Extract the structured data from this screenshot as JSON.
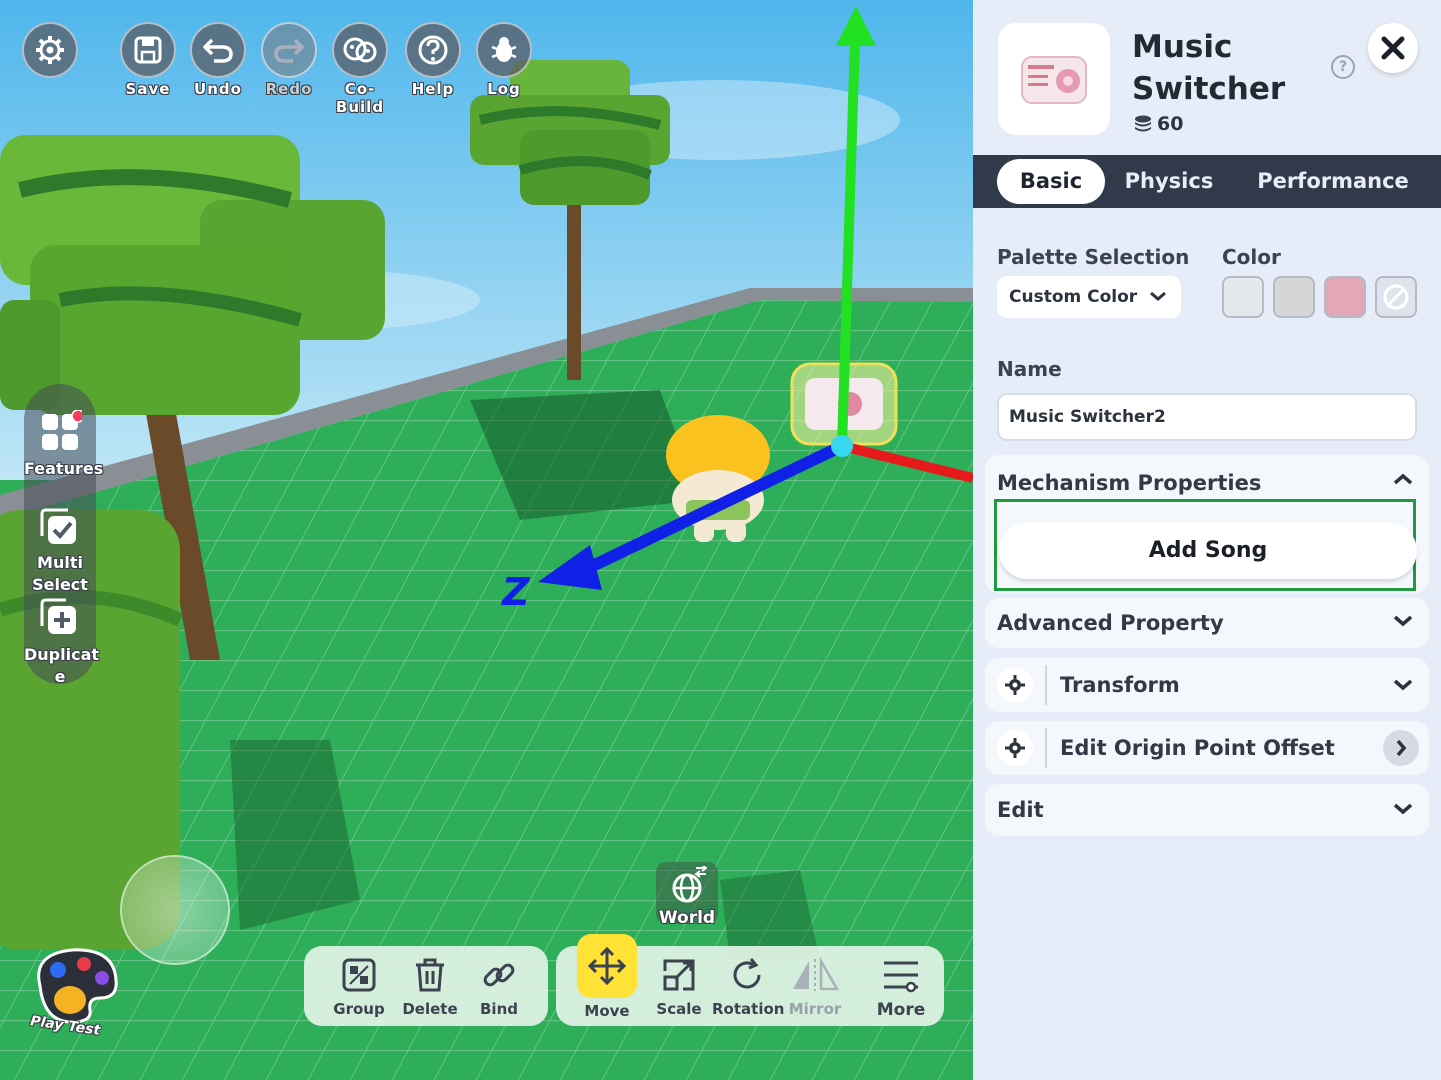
{
  "toolbar": {
    "settings": "",
    "save": "Save",
    "undo": "Undo",
    "redo": "Redo",
    "cobuild": "Co-Build",
    "help": "Help",
    "log": "Log"
  },
  "side_tools": {
    "features": "Features",
    "multi_select": "Multi Select",
    "duplicate": "Duplicat e"
  },
  "scene": {
    "axis_z_label": "Z",
    "world_toggle": "World",
    "play_test": "Play Test"
  },
  "bottom_bar": {
    "group": "Group",
    "delete": "Delete",
    "bind": "Bind",
    "move": "Move",
    "scale": "Scale",
    "rotation": "Rotation",
    "mirror": "Mirror",
    "more": "More"
  },
  "panel": {
    "title": "Music Switcher",
    "cost": "60",
    "help_icon": "?",
    "tabs": [
      "Basic",
      "Physics",
      "Performance"
    ],
    "active_tab": "Basic",
    "palette_label": "Palette Selection",
    "palette_value": "Custom Color",
    "color_label": "Color",
    "colors": [
      "#e4e7ec",
      "#d6d6d8",
      "#e2a8b8"
    ],
    "name_label": "Name",
    "name_value": "Music Switcher2",
    "sections": {
      "mechanism": "Mechanism Properties",
      "add_song": "Add Song",
      "advanced": "Advanced Property",
      "transform": "Transform",
      "origin": "Edit Origin Point Offset",
      "edit": "Edit"
    }
  },
  "colors": {
    "panel_bg": "#e7edf8",
    "tab_bar": "#313a4a",
    "highlight": "#1f9a3e",
    "grid": "#2fae5a",
    "axis_y": "#22e022",
    "axis_z": "#1020e6",
    "axis_x": "#e61a1a"
  }
}
